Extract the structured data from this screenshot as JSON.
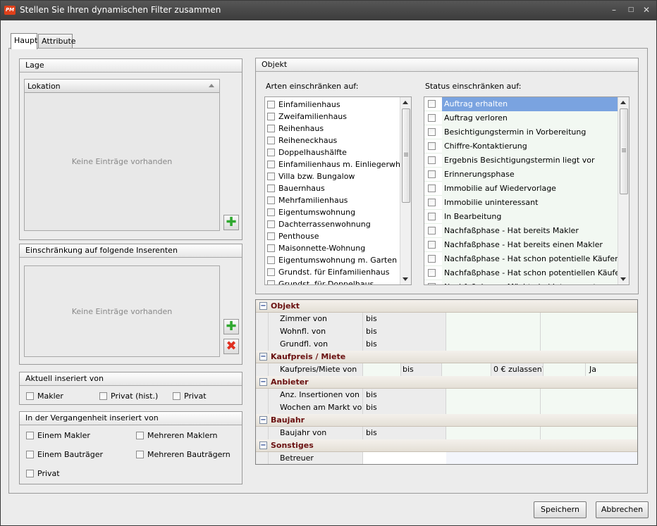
{
  "window": {
    "title": "Stellen Sie Ihren dynamischen Filter zusammen",
    "app_icon_text": "PM",
    "icons": [
      "minimize-icon",
      "maximize-icon",
      "close-icon"
    ]
  },
  "tabs": [
    {
      "label": "Haupt"
    },
    {
      "label": "Attribute"
    }
  ],
  "lage": {
    "title": "Lage",
    "column_header": "Lokation",
    "empty_text": "Keine Einträge vorhanden"
  },
  "inserenten": {
    "title": "Einschränkung auf folgende Inserenten",
    "empty_text": "Keine Einträge vorhanden"
  },
  "aktuell": {
    "title": "Aktuell inseriert von",
    "options": [
      "Makler",
      "Privat (hist.)",
      "Privat"
    ]
  },
  "vergangenheit": {
    "title": "In der Vergangenheit inseriert von",
    "options": [
      "Einem Makler",
      "Mehreren Maklern",
      "Einem Bauträger",
      "Mehreren Bauträgern",
      "Privat"
    ]
  },
  "objekt": {
    "title": "Objekt",
    "arten_label": "Arten einschränken auf:",
    "status_label": "Status einschränken auf:",
    "arten": [
      "Einfamilienhaus",
      "Zweifamilienhaus",
      "Reihenhaus",
      "Reiheneckhaus",
      "Doppelhaushälfte",
      "Einfamilienhaus m. Einliegerwhg.",
      "Villa bzw. Bungalow",
      "Bauernhaus",
      "Mehrfamilienhaus",
      "Eigentumswohnung",
      "Dachterrassenwohnung",
      "Penthouse",
      "Maisonnette-Wohnung",
      "Eigentumswohnung m. Garten",
      "Grundst. für Einfamilienhaus",
      "Grundst. für Doppelhaus"
    ],
    "status": [
      "Auftrag erhalten",
      "Auftrag verloren",
      "Besichtigungstermin in Vorbereitung",
      "Chiffre-Kontaktierung",
      "Ergebnis Besichtigungstermin liegt vor",
      "Erinnerungsphase",
      "Immobilie auf Wiedervorlage",
      "Immobilie uninteressant",
      "In Bearbeitung",
      "Nachfaßphase - Hat bereits Makler",
      "Nachfaßphase - Hat bereits einen Makler",
      "Nachfaßphase - Hat schon potentielle Käufer",
      "Nachfaßphase - Hat schon potentiellen Käufer",
      "Nachfaßphase - Möchte bei Interessenten"
    ],
    "status_selected": "Auftrag erhalten"
  },
  "grid": {
    "groups": [
      {
        "title": "Objekt",
        "rows": [
          {
            "label": "Zimmer von",
            "c2": "bis"
          },
          {
            "label": "Wohnfl. von",
            "c2": "bis"
          },
          {
            "label": "Grundfl. von",
            "c2": "bis"
          }
        ]
      },
      {
        "title": "Kaufpreis / Miete",
        "rows": [
          {
            "label": "Kaufpreis/Miete von",
            "c2": "bis",
            "c3": "0 € zulassen?",
            "c4": "Ja"
          }
        ]
      },
      {
        "title": "Anbieter",
        "rows": [
          {
            "label": "Anz. Insertionen von",
            "c2": "bis"
          },
          {
            "label": "Wochen am Markt von",
            "c2": "bis"
          }
        ]
      },
      {
        "title": "Baujahr",
        "rows": [
          {
            "label": "Baujahr von",
            "c2": "bis"
          }
        ]
      },
      {
        "title": "Sonstiges",
        "rows": [
          {
            "label": "Betreuer"
          }
        ]
      }
    ]
  },
  "buttons": {
    "save": "Speichern",
    "cancel": "Abbrechen"
  },
  "colors": {
    "title_bar": "#3c3c3c",
    "selection": "#7aa3e0",
    "group_text": "#6a1010",
    "add": "#2fa82f",
    "delete": "#e03020"
  }
}
